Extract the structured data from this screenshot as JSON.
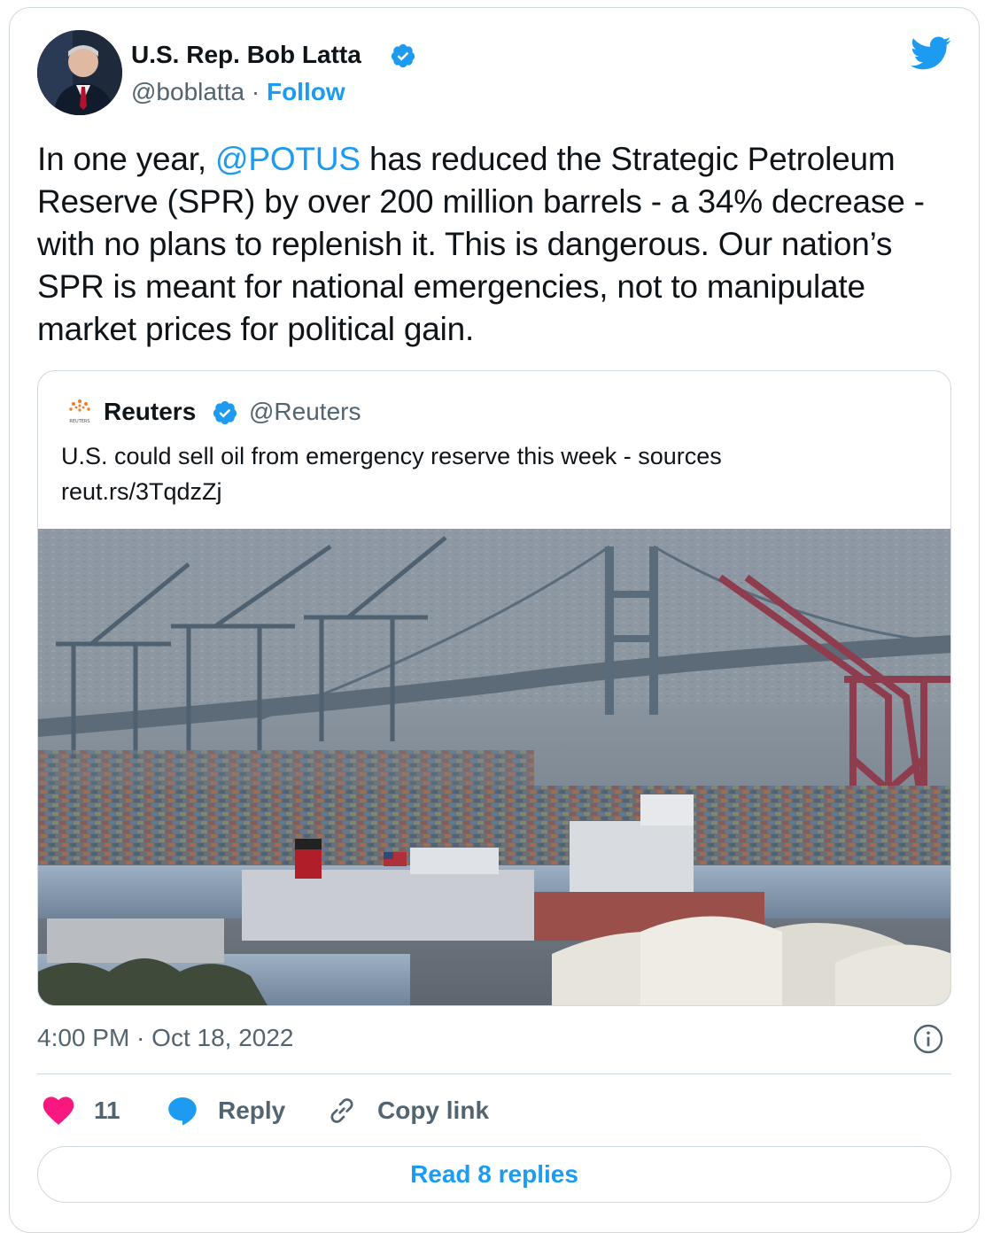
{
  "author": {
    "name": "U.S. Rep. Bob Latta",
    "handle": "@boblatta",
    "separator": "·",
    "follow_label": "Follow"
  },
  "tweet": {
    "text_before": "In one year, ",
    "mention": "@POTUS",
    "text_after": " has reduced the Strategic Petroleum Reserve (SPR) by over 200 million barrels - a 34% decrease - with no plans to replenish it. This is dangerous. Our nation’s SPR is meant for national emergencies, not to manipulate market prices for political gain."
  },
  "quote": {
    "name": "Reuters",
    "handle": "@Reuters",
    "text": "U.S. could sell oil from emergency reserve this week - sources",
    "link": "reut.rs/3TqdzZj",
    "logo_caption": "REUTERS"
  },
  "meta": {
    "timestamp": "4:00 PM · Oct 18, 2022"
  },
  "actions": {
    "like_count": "11",
    "reply_label": "Reply",
    "copy_label": "Copy link"
  },
  "footer": {
    "read_replies_label": "Read 8 replies"
  },
  "icons": {
    "verified": "verified-badge-icon",
    "twitter": "twitter-bird-icon",
    "info": "info-icon",
    "heart": "heart-icon",
    "reply": "speech-bubble-icon",
    "link": "link-chain-icon"
  },
  "colors": {
    "accent": "#1d9bf0",
    "heart": "#f91880",
    "text": "#0f1419",
    "muted": "#536471",
    "border": "#cfd9de"
  }
}
